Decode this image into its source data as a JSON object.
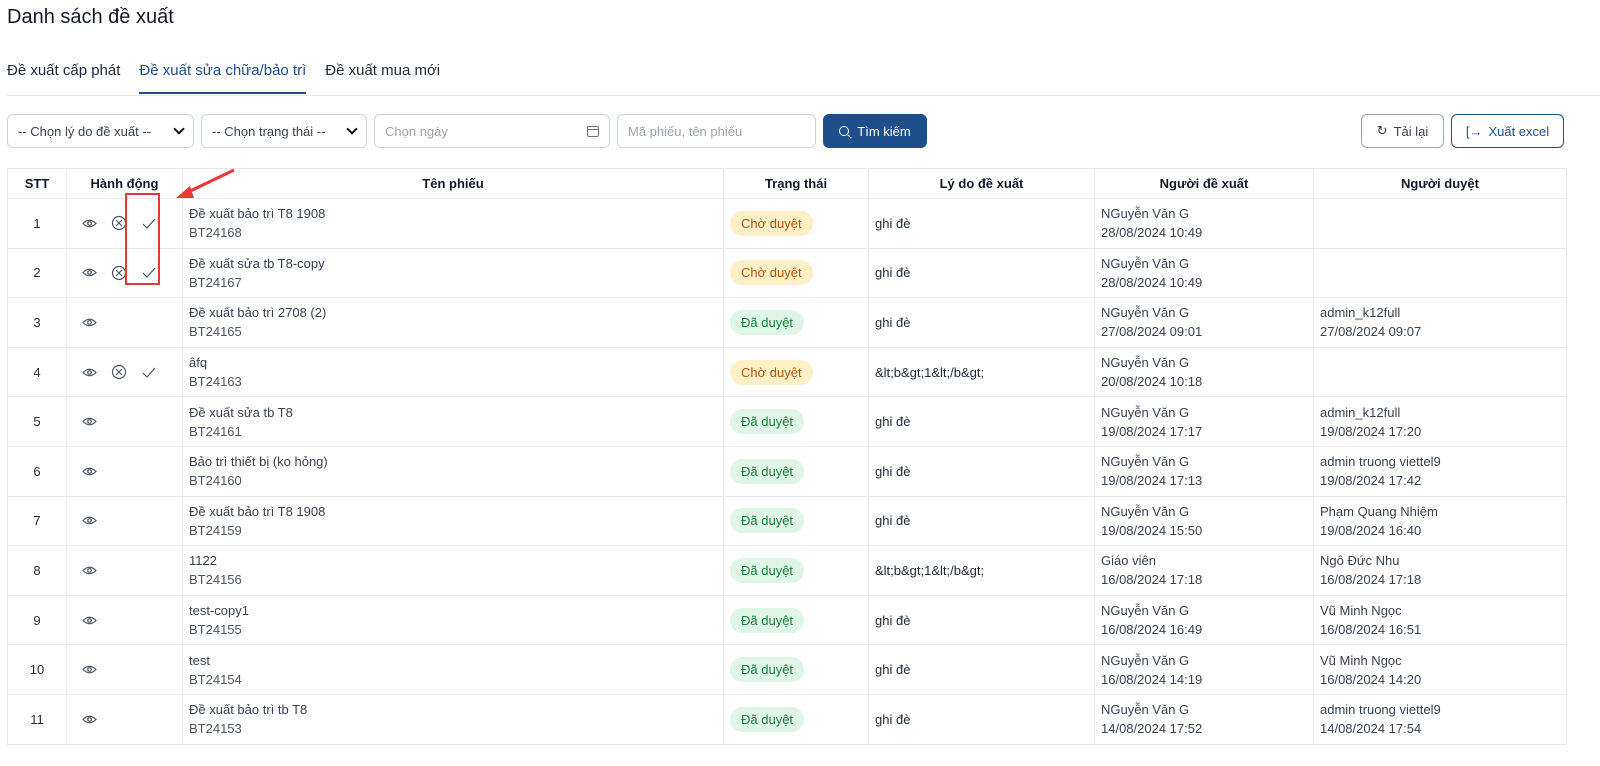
{
  "page": {
    "title": "Danh sách đề xuất"
  },
  "tabs": [
    {
      "label": "Đề xuất cấp phát",
      "active": false
    },
    {
      "label": "Đề xuất sửa chữa/bảo trì",
      "active": true
    },
    {
      "label": "Đề xuất mua mới",
      "active": false
    }
  ],
  "filters": {
    "reason_select": "-- Chọn lý do đề xuất --",
    "status_select": "-- Chọn trạng thái --",
    "date_placeholder": "Chọn ngày",
    "keyword_placeholder": "Mã phiếu, tên phiếu",
    "search_label": "Tìm kiếm",
    "reload_label": "Tải lại",
    "export_label": "Xuất excel"
  },
  "table": {
    "headers": [
      "STT",
      "Hành động",
      "Tên phiếu",
      "Trạng thái",
      "Lý do đề xuất",
      "Người đề xuất",
      "Người duyệt"
    ],
    "rows": [
      {
        "stt": "1",
        "actions": [
          "view",
          "reject",
          "approve"
        ],
        "name": "Đề xuất bảo trì T8 1908",
        "code": "BT24168",
        "status": "Chờ duyệt",
        "reason": "ghi đè",
        "proposer": "NGuyễn Văn G",
        "proposed_at": "28/08/2024 10:49",
        "approver": "",
        "approved_at": ""
      },
      {
        "stt": "2",
        "actions": [
          "view",
          "reject",
          "approve"
        ],
        "name": "Đề xuất sửa tb T8-copy",
        "code": "BT24167",
        "status": "Chờ duyệt",
        "reason": "ghi đè",
        "proposer": "NGuyễn Văn G",
        "proposed_at": "28/08/2024 10:49",
        "approver": "",
        "approved_at": ""
      },
      {
        "stt": "3",
        "actions": [
          "view"
        ],
        "name": "Đề xuất bảo trì 2708 (2)",
        "code": "BT24165",
        "status": "Đã duyệt",
        "reason": "ghi đè",
        "proposer": "NGuyễn Văn G",
        "proposed_at": "27/08/2024 09:01",
        "approver": "admin_k12full",
        "approved_at": "27/08/2024 09:07"
      },
      {
        "stt": "4",
        "actions": [
          "view",
          "reject",
          "approve"
        ],
        "name": "âfq",
        "code": "BT24163",
        "status": "Chờ duyệt",
        "reason": "&lt;b&gt;1&lt;/b&gt;",
        "proposer": "NGuyễn Văn G",
        "proposed_at": "20/08/2024 10:18",
        "approver": "",
        "approved_at": ""
      },
      {
        "stt": "5",
        "actions": [
          "view"
        ],
        "name": "Đề xuất sửa tb T8",
        "code": "BT24161",
        "status": "Đã duyệt",
        "reason": "ghi đè",
        "proposer": "NGuyễn Văn G",
        "proposed_at": "19/08/2024 17:17",
        "approver": "admin_k12full",
        "approved_at": "19/08/2024 17:20"
      },
      {
        "stt": "6",
        "actions": [
          "view"
        ],
        "name": "Bảo trì thiết bị (ko hỏng)",
        "code": "BT24160",
        "status": "Đã duyệt",
        "reason": "ghi đè",
        "proposer": "NGuyễn Văn G",
        "proposed_at": "19/08/2024 17:13",
        "approver": "admin truong viettel9",
        "approved_at": "19/08/2024 17:42"
      },
      {
        "stt": "7",
        "actions": [
          "view"
        ],
        "name": "Đề xuất bảo trì T8 1908",
        "code": "BT24159",
        "status": "Đã duyệt",
        "reason": "ghi đè",
        "proposer": "NGuyễn Văn G",
        "proposed_at": "19/08/2024 15:50",
        "approver": "Phạm Quang Nhiệm",
        "approved_at": "19/08/2024 16:40"
      },
      {
        "stt": "8",
        "actions": [
          "view"
        ],
        "name": "1122",
        "code": "BT24156",
        "status": "Đã duyệt",
        "reason": "&lt;b&gt;1&lt;/b&gt;",
        "proposer": "Giáo viên",
        "proposed_at": "16/08/2024 17:18",
        "approver": "Ngô Đức Nhu",
        "approved_at": "16/08/2024 17:18"
      },
      {
        "stt": "9",
        "actions": [
          "view"
        ],
        "name": "test-copy1",
        "code": "BT24155",
        "status": "Đã duyệt",
        "reason": "ghi đè",
        "proposer": "NGuyễn Văn G",
        "proposed_at": "16/08/2024 16:49",
        "approver": "Vũ Minh Ngọc",
        "approved_at": "16/08/2024 16:51"
      },
      {
        "stt": "10",
        "actions": [
          "view"
        ],
        "name": "test",
        "code": "BT24154",
        "status": "Đã duyệt",
        "reason": "ghi đè",
        "proposer": "NGuyễn Văn G",
        "proposed_at": "16/08/2024 14:19",
        "approver": "Vũ Minh Ngọc",
        "approved_at": "16/08/2024 14:20"
      },
      {
        "stt": "11",
        "actions": [
          "view"
        ],
        "name": "Đề xuất bảo trì tb T8",
        "code": "BT24153",
        "status": "Đã duyệt",
        "reason": "ghi đè",
        "proposer": "NGuyễn Văn G",
        "proposed_at": "14/08/2024 17:52",
        "approver": "admin truong viettel9",
        "approved_at": "14/08/2024 17:54"
      }
    ]
  },
  "colors": {
    "primary": "#1f4e8c",
    "pending_bg": "#fdf0c7",
    "pending_text": "#b45309",
    "approved_bg": "#dff5e5",
    "approved_text": "#15803d",
    "annotation": "#e53935"
  },
  "icons": {
    "view": "eye-icon",
    "reject": "circle-x-icon",
    "approve": "check-icon",
    "search": "search-icon",
    "reload": "refresh-icon",
    "export": "export-icon",
    "date": "calendar-icon"
  }
}
